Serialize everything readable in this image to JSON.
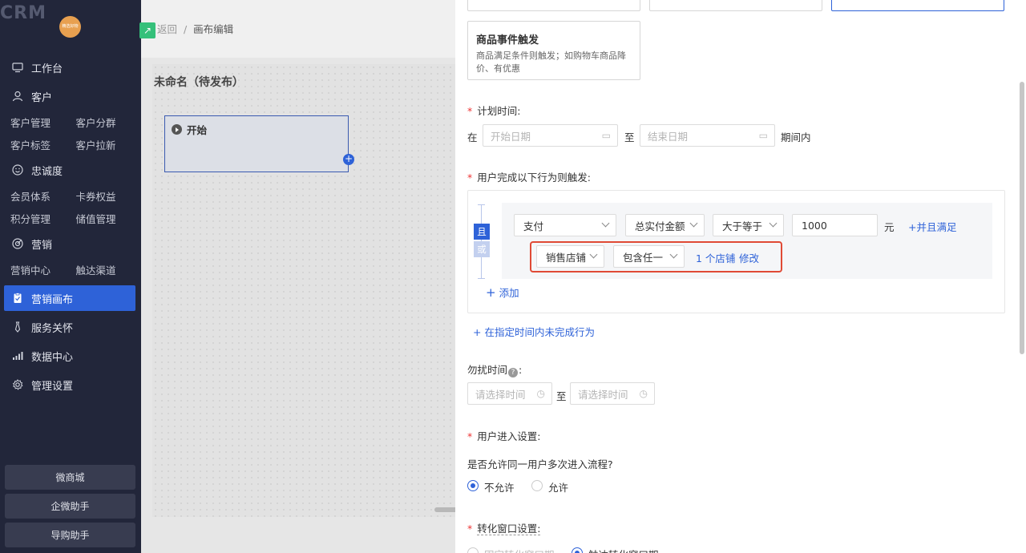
{
  "sidebar": {
    "logo": "CRM",
    "avatar_text": "精选好物",
    "menu": [
      {
        "key": "workbench",
        "label": "工作台",
        "icon": "monitor-icon"
      },
      {
        "key": "customer",
        "label": "客户",
        "icon": "user-icon",
        "subs": [
          "客户管理",
          "客户分群",
          "客户标签",
          "客户拉新"
        ]
      },
      {
        "key": "loyalty",
        "label": "忠诚度",
        "icon": "smile-icon",
        "subs": [
          "会员体系",
          "卡券权益",
          "积分管理",
          "储值管理"
        ]
      },
      {
        "key": "marketing",
        "label": "营销",
        "icon": "target-icon",
        "subs": [
          "营销中心",
          "触达渠道"
        ]
      },
      {
        "key": "canvas",
        "label": "营销画布",
        "icon": "clipboard-icon",
        "active": true
      },
      {
        "key": "care",
        "label": "服务关怀",
        "icon": "tie-icon"
      },
      {
        "key": "data",
        "label": "数据中心",
        "icon": "bar-chart-icon"
      },
      {
        "key": "settings",
        "label": "管理设置",
        "icon": "gear-icon"
      }
    ],
    "bottom": [
      "微商城",
      "企微助手",
      "导购助手"
    ]
  },
  "main": {
    "breadcrumb_back": "返回",
    "breadcrumb_sep": "/",
    "breadcrumb_current": "画布编辑",
    "canvas_title": "未命名（待发布）",
    "start_node": "开始"
  },
  "drawer": {
    "event_card": {
      "title": "商品事件触发",
      "desc": "商品满足条件则触发；如购物车商品降价、有优惠"
    },
    "plan_time": {
      "label": "计划时间:",
      "prefix": "在",
      "start_placeholder": "开始日期",
      "to": "至",
      "end_placeholder": "结束日期",
      "suffix": "期间内"
    },
    "behavior": {
      "label": "用户完成以下行为则触发:",
      "and": "且",
      "or": "或",
      "row1": {
        "action": "支付",
        "metric": "总实付金额",
        "op": "大于等于",
        "value": "1000",
        "unit": "元",
        "and_link": "+并且满足"
      },
      "row2": {
        "field": "销售店铺",
        "op": "包含任一",
        "count": "1 个店铺",
        "edit": "修改"
      },
      "add": "添加",
      "not_done": "+ 在指定时间内未完成行为"
    },
    "dnd": {
      "label": "勿扰时间",
      "help": "?",
      "colon": ":",
      "start_placeholder": "请选择时间",
      "to": "至",
      "end_placeholder": "请选择时间"
    },
    "entry": {
      "label": "用户进入设置:",
      "question": "是否允许同一用户多次进入流程?",
      "options": [
        "不允许",
        "允许"
      ]
    },
    "conversion": {
      "label": "转化窗口设置:",
      "options": [
        "固定转化窗口期",
        "触达转化窗口期"
      ]
    }
  }
}
